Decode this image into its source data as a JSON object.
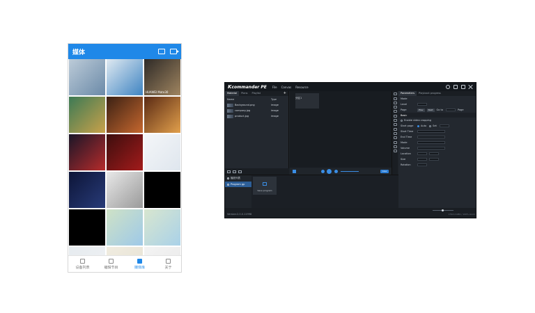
{
  "phone": {
    "header": {
      "title": "媒体",
      "image_icon": "image-icon",
      "video_icon": "video-icon"
    },
    "grid": [
      {
        "color_a": "#bccbd8",
        "color_b": "#6b8aa8",
        "caption": ""
      },
      {
        "color_a": "#dfe9f1",
        "color_b": "#3f84c2",
        "caption": ""
      },
      {
        "color_a": "#2e2a27",
        "color_b": "#a08560",
        "caption": "HUAWEI Mate30"
      },
      {
        "color_a": "#3c7a55",
        "color_b": "#c9a14a",
        "caption": ""
      },
      {
        "color_a": "#3b2114",
        "color_b": "#c6672e",
        "caption": ""
      },
      {
        "color_a": "#5a2a14",
        "color_b": "#e2a04c",
        "caption": ""
      },
      {
        "color_a": "#1a1628",
        "color_b": "#b62b2b",
        "caption": ""
      },
      {
        "color_a": "#3d0e0e",
        "color_b": "#a31b1b",
        "caption": ""
      },
      {
        "color_a": "#f4f6f8",
        "color_b": "#dfe6ee",
        "caption": ""
      },
      {
        "color_a": "#0d1538",
        "color_b": "#283b78",
        "caption": ""
      },
      {
        "color_a": "#e8e8e8",
        "color_b": "#9a9a9a",
        "caption": ""
      },
      {
        "color_a": "#000000",
        "color_b": "#000000",
        "caption": ""
      },
      {
        "color_a": "#000000",
        "color_b": "#000000",
        "caption": ""
      },
      {
        "color_a": "#cfe2c6",
        "color_b": "#9ec9e8",
        "caption": ""
      },
      {
        "color_a": "#d8e6cf",
        "color_b": "#a9d1e8",
        "caption": ""
      },
      {
        "color_a": "#e6ebef",
        "color_b": "#f0f2f4",
        "caption": ""
      },
      {
        "color_a": "#f0ece0",
        "color_b": "#e6e1d3",
        "caption": ""
      },
      {
        "color_a": "#f3f3f3",
        "color_b": "#e9e9e9",
        "caption": ""
      }
    ],
    "tabs": [
      {
        "label": "设备列表",
        "active": false
      },
      {
        "label": "编辑节目",
        "active": false
      },
      {
        "label": "媒体库",
        "active": true
      },
      {
        "label": "关于",
        "active": false
      }
    ]
  },
  "app": {
    "logo": "commander PE",
    "menu": [
      "File",
      "Canvas",
      "Resource"
    ],
    "left_tabs": [
      "Material",
      "Plans",
      "Playlist"
    ],
    "table": {
      "headers": [
        "Name",
        "Type"
      ],
      "rows": [
        {
          "name": "Background.png",
          "type": "image"
        },
        {
          "name": "company.jpg",
          "type": "image"
        },
        {
          "name": "product.jpg",
          "type": "image"
        }
      ]
    },
    "canvas_label": "分区1",
    "live_label": "Live",
    "prop_tabs": [
      "Parameters",
      "Playback progress"
    ],
    "props": {
      "mode": "Mode",
      "level": "Level",
      "page": "Page",
      "page_btn1": "Prev",
      "page_btn2": "Next",
      "page_go": "Go to",
      "page_unit": "Page",
      "section_basic": "Basic",
      "enable_cropping": "Enable video cropping",
      "start_page": "Start page",
      "auto": "Auto",
      "set": "Set",
      "start_time": "Start Time",
      "end_time": "End Time",
      "mode2": "Mode",
      "volume": "Volume",
      "location": "Location",
      "size": "Size",
      "rotation": "Rotation"
    },
    "playlist": [
      "播放列表",
      "Program gp"
    ],
    "save_label": "Save program",
    "version": "Version:2.0.0.11998",
    "status_right": "1792×1080 / 100% zoom"
  }
}
